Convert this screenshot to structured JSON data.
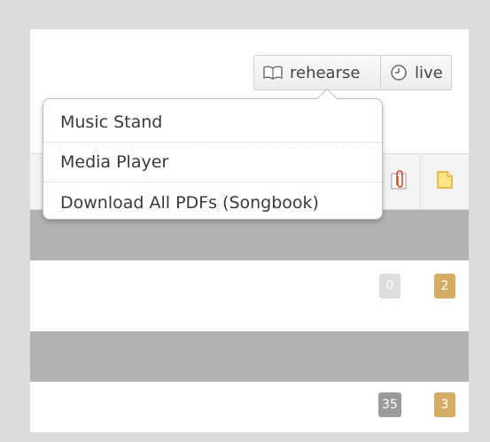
{
  "toolbar": {
    "rehearse_label": "rehearse",
    "live_label": "live",
    "rehearse_icon": "book-icon",
    "live_icon": "clock-icon"
  },
  "header": {
    "attachment_icon": "paperclip-icon",
    "note_icon": "note-icon"
  },
  "menu": {
    "items": [
      {
        "label": "Music Stand"
      },
      {
        "label": "Media Player"
      },
      {
        "label": "Download All PDFs (Songbook)"
      }
    ]
  },
  "rows": [
    {
      "attachment_count": "0",
      "note_count": "2"
    },
    {
      "attachment_count": "35",
      "note_count": "3"
    }
  ],
  "colors": {
    "group_bar": "#b2b2b2",
    "badge_empty": "#dddddd",
    "badge_attach": "#9b9b9b",
    "badge_note": "#d5ac63",
    "note_icon_fill": "#ffe385",
    "note_icon_stroke": "#e0a92f"
  }
}
